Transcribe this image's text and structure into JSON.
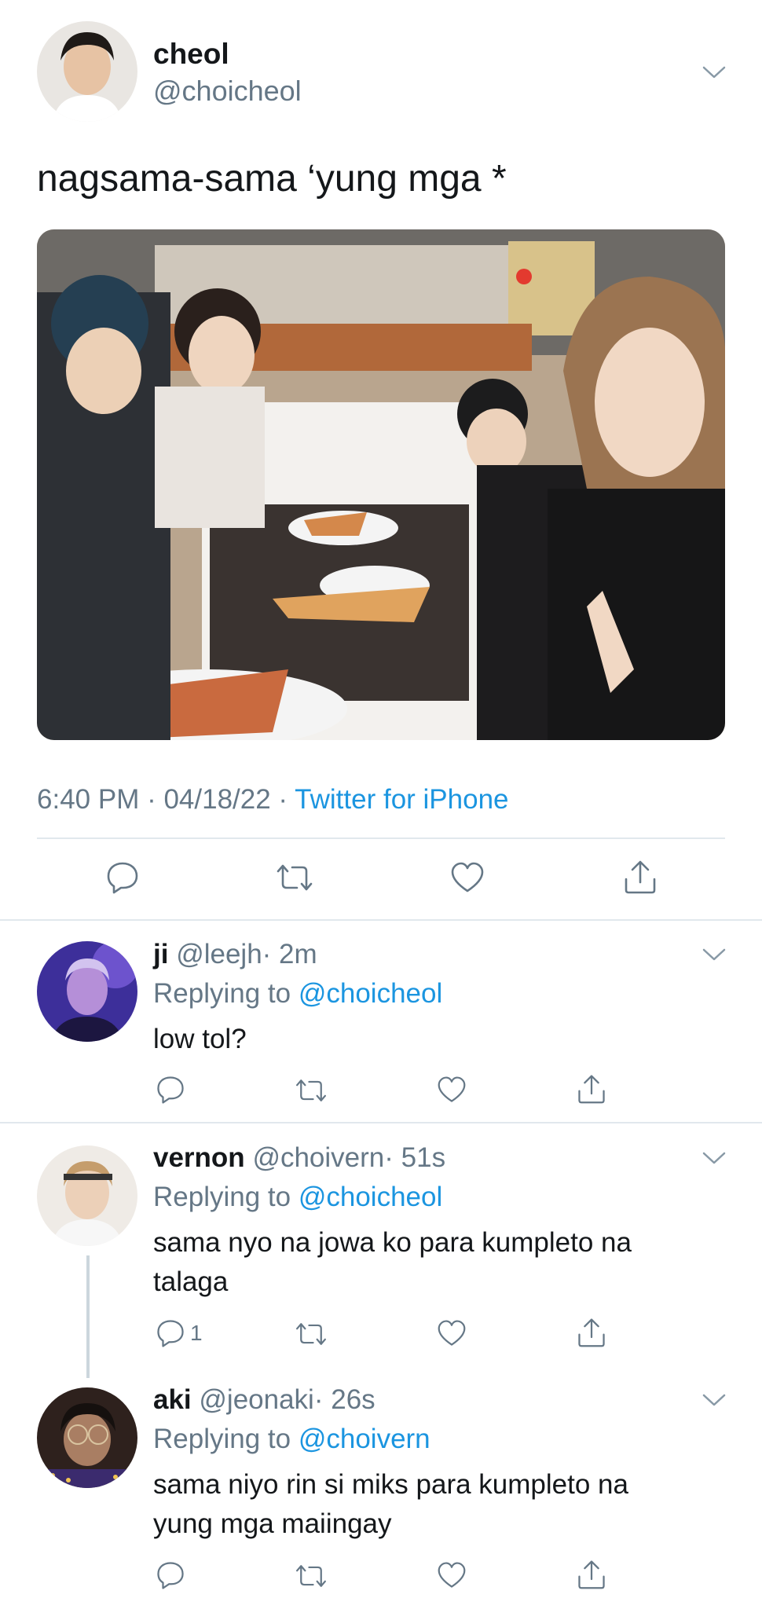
{
  "main_tweet": {
    "name": "cheol",
    "handle": "@choicheol",
    "text": "nagsama-sama ‘yung mga *",
    "time": "6:40 PM · 04/18/22 · ",
    "source": "Twitter for iPhone",
    "avatar_color": "#d9c7b4"
  },
  "replies": [
    {
      "name": "ji",
      "handle": "@leejh",
      "time": "· 2m",
      "replying_prefix": "Replying to ",
      "replying_to": "@choicheol",
      "lines": [
        "low tol?"
      ],
      "reply_count": "",
      "avatar_color": "#4a3aa8"
    },
    {
      "name": "vernon",
      "handle": "@choivern",
      "time": "· 51s",
      "replying_prefix": "Replying to ",
      "replying_to": "@choicheol",
      "lines": [
        "sama nyo na jowa ko para kumpleto na",
        "talaga"
      ],
      "reply_count": "1",
      "avatar_color": "#e8e3dc"
    },
    {
      "name": "aki",
      "handle": "@jeonaki",
      "time": "· 26s",
      "replying_prefix": "Replying to ",
      "replying_to": "@choivern",
      "lines": [
        "sama niyo rin si miks para kumpleto na",
        "yung mga maiingay"
      ],
      "reply_count": "",
      "avatar_color": "#3b2a24"
    }
  ],
  "colors": {
    "text": "#14171a",
    "secondary": "#657786",
    "link": "#1b95e0",
    "divider": "#e1e8ed"
  }
}
